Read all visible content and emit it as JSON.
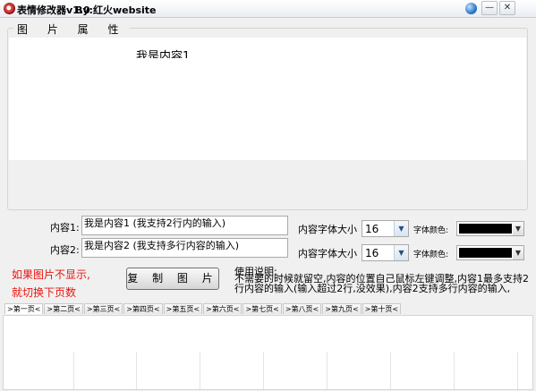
{
  "window": {
    "title": "表情修改器v1.0",
    "author": "By:红火website",
    "buttons": {
      "minimize": "—",
      "close": "✕"
    }
  },
  "picture_group": {
    "title": "图 片 属 性",
    "preview_text": "我是内容1"
  },
  "content1": {
    "label": "内容1:",
    "value": "我是内容1 (我支持2行内的输入)",
    "font_size_label": "内容字体大小",
    "font_size_value": "16",
    "font_color_label": "字体颜色:",
    "font_color": "#000000"
  },
  "content2": {
    "label": "内容2:",
    "value": "我是内容2 (我支持多行内容的输入)",
    "font_size_label": "内容字体大小",
    "font_size_value": "16",
    "font_color_label": "字体颜色:",
    "font_color": "#000000"
  },
  "notes": {
    "line1": "如果图片不显示,",
    "line2": "就切换下页数",
    "color": "#e8150f"
  },
  "copy_button": "复 制 图 片",
  "usage": {
    "title": "使用说明:",
    "text": "不需要的时候就留空,内容的位置自己鼠标左键调整,内容1最多支持2行内容的输入(输入超过2行,没效果),内容2支持多行内容的输入,"
  },
  "page_tabs": [
    "第一页",
    "第二页",
    "第三页",
    "第四页",
    "第五页",
    "第六页",
    "第七页",
    "第八页",
    "第九页",
    "第十页"
  ],
  "page_tab_prefix": ">",
  "page_tab_suffix": "<",
  "active_tab_index": 0
}
